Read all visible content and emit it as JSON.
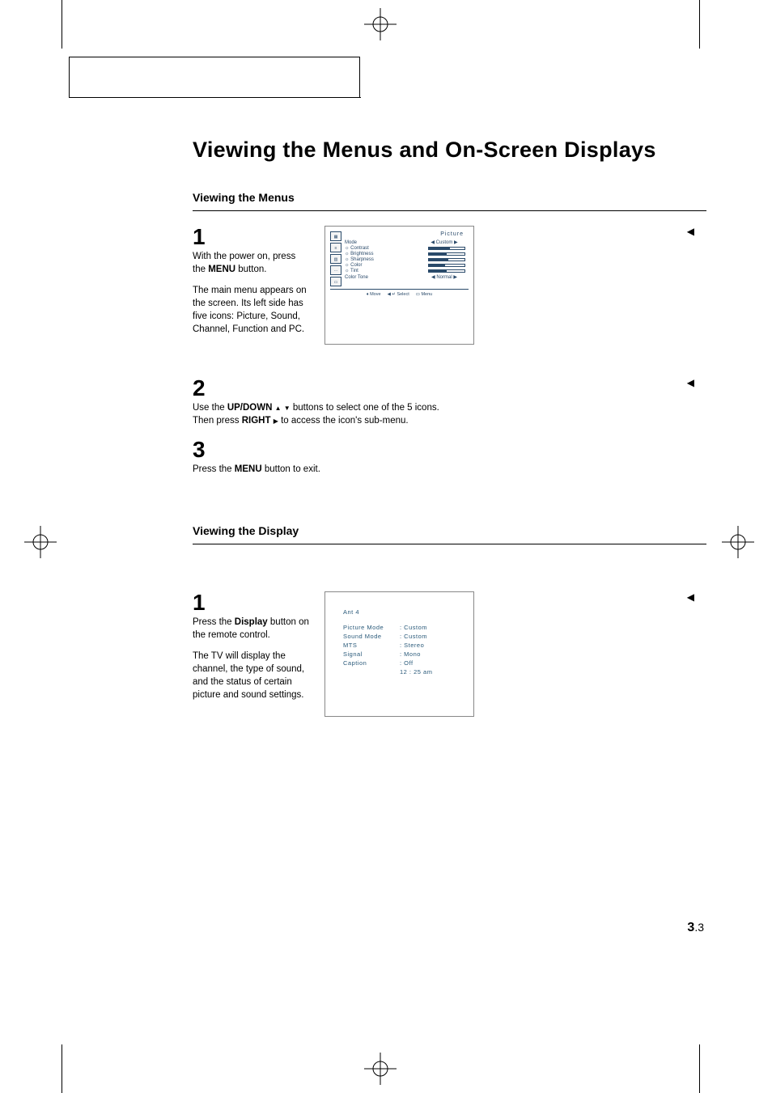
{
  "page_title": "Viewing the Menus and On-Screen Displays",
  "section1": {
    "heading": "Viewing the Menus",
    "step1_num": "1",
    "step1_a": "With the power on, press the ",
    "step1_menu": "MENU",
    "step1_b": " button.",
    "step1_c": "The main menu appears on the screen. Its left side has five icons: Picture, Sound, Channel, Function and PC.",
    "step2_num": "2",
    "step2_a": "Use the ",
    "step2_updown": "UP/DOWN",
    "step2_b": " buttons to select one of the 5 icons. Then press ",
    "step2_right": "RIGHT",
    "step2_c": " to access the icon's sub-menu.",
    "step3_num": "3",
    "step3_a": "Press the ",
    "step3_menu": "MENU",
    "step3_b": " button to exit."
  },
  "section2": {
    "heading": "Viewing the Display",
    "step1_num": "1",
    "step1_a": "Press the ",
    "step1_disp": "Display",
    "step1_b": " button on the remote control.",
    "step1_c": "The TV will display the channel, the type of sound, and the status of certain picture and sound settings."
  },
  "osd1": {
    "title": "Picture",
    "rows": {
      "mode_label": "Mode",
      "mode_value": "◀ Custom ▶",
      "contrast": "☼ Contrast",
      "brightness": "☼ Brightness",
      "sharpness": "☼ Sharpness",
      "color": "☼ Color",
      "tint": "☼ Tint",
      "colortone_label": "Color Tone",
      "colortone_value": "◀ Normal ▶"
    },
    "footer": {
      "move": "♦ Move",
      "select": "◀ ↵ Select",
      "menu": "▭ Menu"
    }
  },
  "osd2": {
    "header": "Ant    4",
    "rows": [
      {
        "l": "Picture Mode",
        "r": ": Custom"
      },
      {
        "l": "Sound Mode",
        "r": ": Custom"
      },
      {
        "l": "MTS",
        "r": ": Stereo"
      },
      {
        "l": "Signal",
        "r": ": Mono"
      },
      {
        "l": "Caption",
        "r": ": Off"
      },
      {
        "l": "",
        "r": "12 : 25 am"
      }
    ]
  },
  "page_number": {
    "chapter": "3",
    "page": ".3"
  },
  "chart_data": null
}
